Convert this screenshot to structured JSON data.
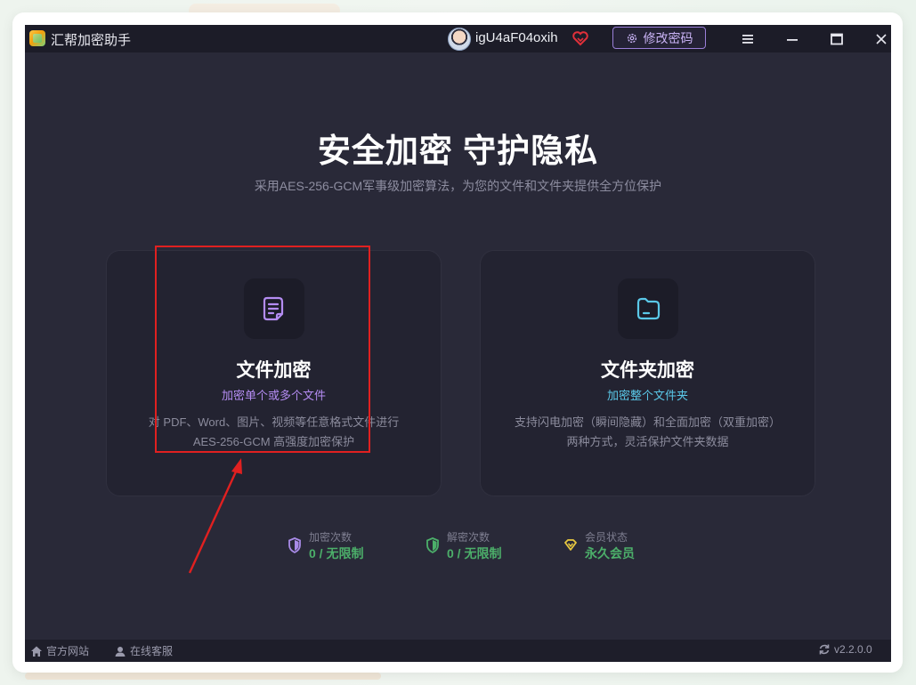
{
  "titlebar": {
    "app_name": "汇帮加密助手",
    "username": "igU4aF04oxih",
    "change_password_label": "修改密码"
  },
  "hero": {
    "title": "安全加密 守护隐私",
    "subtitle": "采用AES-256-GCM军事级加密算法，为您的文件和文件夹提供全方位保护"
  },
  "cards": [
    {
      "title": "文件加密",
      "tag": "加密单个或多个文件",
      "desc_line1": "对 PDF、Word、图片、视频等任意格式文件进行",
      "desc_line2": "AES-256-GCM 高强度加密保护",
      "icon": "file-icon",
      "accent": "#b48cf2"
    },
    {
      "title": "文件夹加密",
      "tag": "加密整个文件夹",
      "desc_line1": "支持闪电加密（瞬间隐藏）和全面加密（双重加密）",
      "desc_line2": "两种方式，灵活保护文件夹数据",
      "icon": "folder-icon",
      "accent": "#5ac8e8"
    }
  ],
  "stats": [
    {
      "label": "加密次数",
      "value": "0 / 无限制",
      "icon": "shield-icon",
      "color": "#a98be8"
    },
    {
      "label": "解密次数",
      "value": "0 / 无限制",
      "icon": "shield-icon",
      "color": "#4caf6a"
    },
    {
      "label": "会员状态",
      "value": "永久会员",
      "icon": "diamond-icon",
      "color": "#e8c840"
    }
  ],
  "footer": {
    "website_label": "官方网站",
    "support_label": "在线客服",
    "version": "v2.2.0.0"
  },
  "colors": {
    "window_bg": "#292938",
    "titlebar_bg": "#1c1c28",
    "value_green": "#4caf6a",
    "annotation_red": "#e02020"
  }
}
